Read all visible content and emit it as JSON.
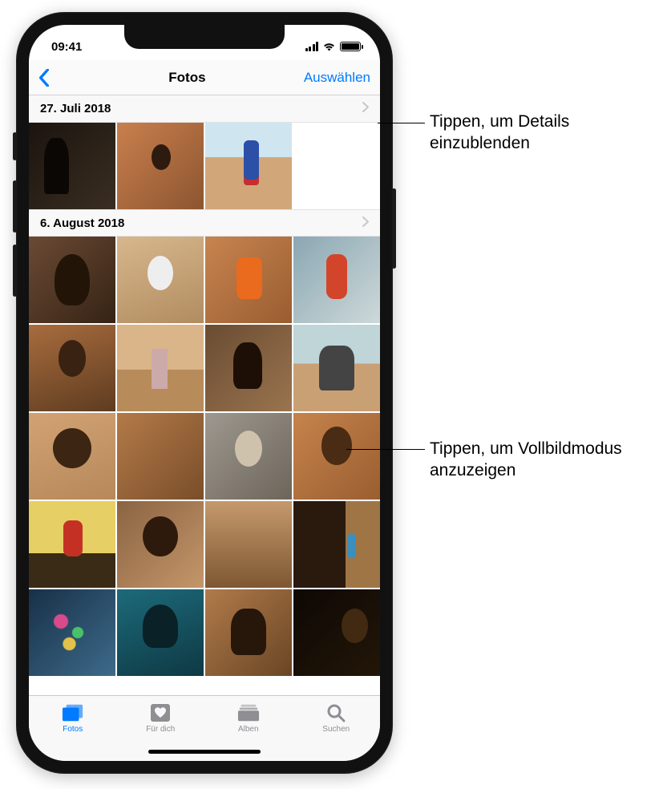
{
  "status": {
    "time": "09:41"
  },
  "nav": {
    "title": "Fotos",
    "select": "Auswählen"
  },
  "sections": [
    {
      "date": "27. Juli 2018"
    },
    {
      "date": "6. August 2018"
    }
  ],
  "tabs": {
    "photos": "Fotos",
    "for_you": "Für dich",
    "albums": "Alben",
    "search": "Suchen"
  },
  "callouts": {
    "details": "Tippen, um Details einzublenden",
    "fullscreen": "Tippen, um Vollbildmodus anzuzeigen"
  }
}
